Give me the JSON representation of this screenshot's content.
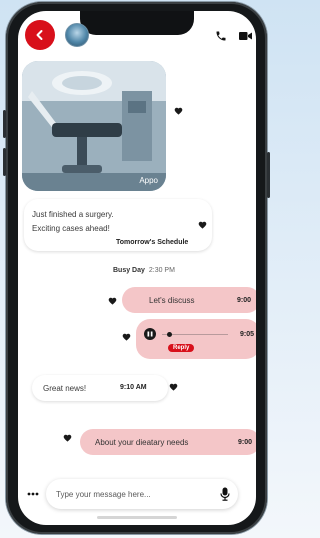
{
  "header": {
    "back_icon": "back-arrow-icon",
    "avatar_icon": "contact-avatar",
    "call_icon": "phone-icon",
    "video_icon": "video-camera-icon",
    "accent_color": "#d8101b"
  },
  "messages": {
    "image_message": {
      "caption": "Appo"
    },
    "surgery_message": {
      "line1": "Just finished a surgery.",
      "line2": "Exciting cases ahead!",
      "link": "Tomorrow's Schedule"
    },
    "divider": {
      "label": "Busy Day",
      "time": "2:30 PM"
    },
    "discuss_message": {
      "text": "Let's discuss",
      "time": "9:00"
    },
    "voice_message": {
      "time": "9:05",
      "reply_label": "Reply",
      "progress": 0.1
    },
    "great_news_message": {
      "text": "Great news!",
      "time": "9:10 AM"
    },
    "dietary_message": {
      "text": "About your dieatary needs",
      "time": "9:00"
    }
  },
  "composer": {
    "more_icon": "more-dots-icon",
    "placeholder": "Type your message here...",
    "mic_icon": "microphone-icon"
  },
  "colors": {
    "outgoing_bubble": "#f4c6c8",
    "incoming_bubble": "#ffffff",
    "heart": "#1a1a1a"
  }
}
